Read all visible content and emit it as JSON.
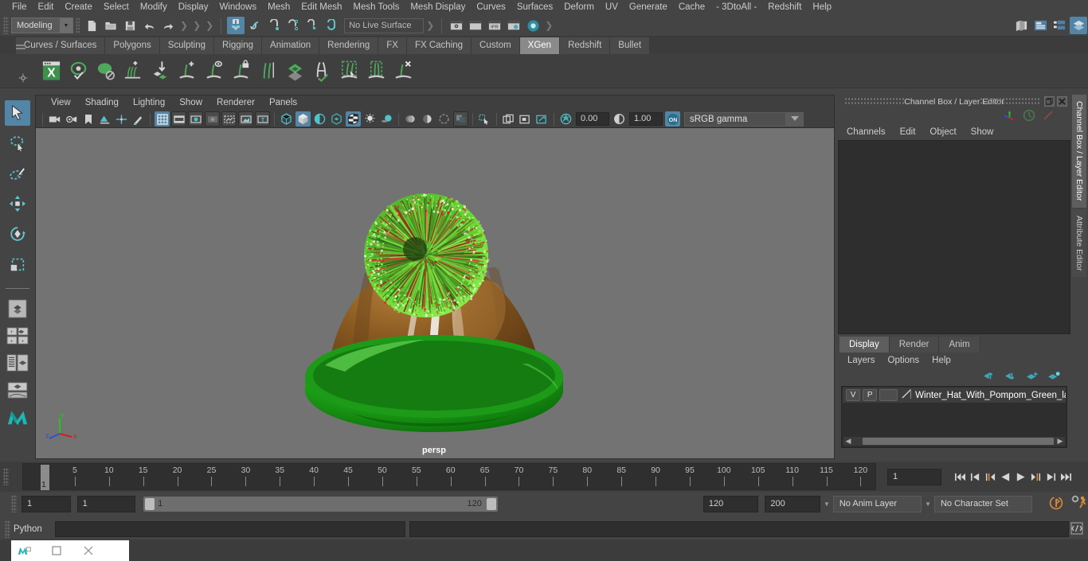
{
  "menubar": {
    "items": [
      "File",
      "Edit",
      "Create",
      "Select",
      "Modify",
      "Display",
      "Windows",
      "Mesh",
      "Edit Mesh",
      "Mesh Tools",
      "Mesh Display",
      "Curves",
      "Surfaces",
      "Deform",
      "UV",
      "Generate",
      "Cache",
      "- 3DtoAll -",
      "Redshift",
      "Help"
    ]
  },
  "statusline": {
    "mode": "Modeling",
    "live_surface": "No Live Surface",
    "icons": [
      "new-scene-icon",
      "open-scene-icon",
      "save-scene-icon",
      "undo-icon",
      "redo-icon",
      "select-by-hierarchy-icon",
      "select-by-object-icon",
      "select-by-component-icon",
      "snap-to-grid-icon",
      "snap-to-curve-icon",
      "snap-to-point-icon",
      "snap-to-projected-center-icon",
      "snap-to-view-plane-icon",
      "make-live-icon",
      "render-view-icon",
      "render-current-frame-icon",
      "ipr-render-icon",
      "render-settings-icon",
      "hypershade-icon"
    ],
    "right_icons": [
      "show-hide-modeling-panel-icon",
      "show-hide-attribute-panel-icon",
      "show-hide-tool-settings-icon",
      "show-hide-channel-box-icon"
    ],
    "ipr_label": "IPR"
  },
  "shelf": {
    "tabs": [
      "Curves / Surfaces",
      "Polygons",
      "Sculpting",
      "Rigging",
      "Animation",
      "Rendering",
      "FX",
      "FX Caching",
      "Custom",
      "XGen",
      "Redshift",
      "Bullet"
    ],
    "active_tab": "XGen",
    "icons": [
      "xgen-editor-icon",
      "xgen-preview-visible-icon",
      "xgen-preview-off-icon",
      "xgen-add-description-icon",
      "xgen-import-collection-icon",
      "xgen-add-guide-icon",
      "xgen-select-guide-icon",
      "xgen-freeze-guide-icon",
      "xgen-duplicate-guide-icon",
      "xgen-convert-primitives-icon",
      "xgen-groom-tool-icon",
      "xgen-guide-region-icon",
      "xgen-clump-modifier-icon",
      "xgen-delete-guide-icon"
    ]
  },
  "toolbox": {
    "tools": [
      "select-tool",
      "lasso-select-tool",
      "paint-select-tool",
      "move-tool",
      "rotate-tool",
      "scale-tool"
    ],
    "active_tool": "select-tool",
    "layout_buttons": [
      "single-perspective-view-icon",
      "four-view-layout-icon",
      "outliner-persp-layout-icon",
      "persp-graph-layout-icon",
      "hypershade-persp-layout-icon",
      "maya-logo-icon"
    ]
  },
  "viewport": {
    "panel_menus": [
      "View",
      "Shading",
      "Lighting",
      "Show",
      "Renderer",
      "Panels"
    ],
    "camera_label": "persp",
    "exposure_value": "0.00",
    "gamma_value": "1.00",
    "color_space": "sRGB gamma",
    "toolbar_icons": [
      "select-camera-icon",
      "camera-attributes-icon",
      "bookmark-icon",
      "image-plane-icon",
      "two-d-pan-zoom-icon",
      "grease-pencil-icon",
      "grid-toggle-icon",
      "film-gate-icon",
      "resolution-gate-icon",
      "gate-mask-icon",
      "film-origin-icon",
      "safe-action-icon",
      "safe-title-icon",
      "wireframe-icon",
      "smooth-shade-all-icon",
      "shaded-wireframe-icon",
      "use-all-lights-icon",
      "shadows-icon",
      "screen-space-ao-icon",
      "motion-blur-icon",
      "multisample-aa-icon",
      "depth-of-field-icon",
      "isolate-select-icon",
      "xray-icon",
      "xray-joints-icon",
      "xray-active-components-icon",
      "exposure-icon",
      "gamma-icon",
      "view-transform-icon"
    ],
    "axis_labels": {
      "x": "x",
      "y": "y",
      "z": "z"
    },
    "scene": {
      "object_name": "Winter Hat With Pompom Green",
      "hat_body_color": "#8a5a21",
      "hat_brim_color": "#1f9f1a",
      "pompom_color_a": "#4fbf1f",
      "pompom_color_b": "#c11f1f",
      "background_color": "#737373"
    }
  },
  "channel_box": {
    "title": "Channel Box / Layer Editor",
    "menus": [
      "Channels",
      "Edit",
      "Object",
      "Show"
    ],
    "header_icons": [
      "axis-orientation-icon",
      "channel-speed-icon",
      "channel-key-icon"
    ],
    "window_buttons": [
      "undock-icon",
      "close-icon"
    ]
  },
  "layer_editor": {
    "tabs": [
      "Display",
      "Render",
      "Anim"
    ],
    "active_tab": "Display",
    "menus": [
      "Layers",
      "Options",
      "Help"
    ],
    "buttons": [
      "move-layer-up-icon",
      "move-layer-down-icon",
      "create-new-layer-icon",
      "create-layer-from-selected-icon"
    ],
    "columns": [
      "V",
      "P"
    ],
    "layers": [
      {
        "visible": "V",
        "playback": "P",
        "name": "Winter_Hat_With_Pompom_Green_lay"
      }
    ]
  },
  "side_tabs": {
    "items": [
      "Channel Box / Layer Editor",
      "Attribute Editor"
    ],
    "active": "Channel Box / Layer Editor"
  },
  "time_slider": {
    "current_frame": "1",
    "frame_field": "1",
    "ticks": [
      5,
      10,
      15,
      20,
      25,
      30,
      35,
      40,
      45,
      50,
      55,
      60,
      65,
      70,
      75,
      80,
      85,
      90,
      95,
      100,
      105,
      110,
      115,
      120
    ],
    "playback_buttons": [
      "go-to-start-icon",
      "step-back-keyframe-icon",
      "step-back-frame-icon",
      "play-backwards-icon",
      "play-forwards-icon",
      "step-forward-frame-icon",
      "step-forward-keyframe-icon",
      "go-to-end-icon"
    ]
  },
  "range_slider": {
    "anim_start": "1",
    "range_start": "1",
    "range_bar_start": "1",
    "range_bar_end": "120",
    "range_end": "120",
    "anim_end": "200",
    "anim_layer": "No Anim Layer",
    "character_set": "No Character Set",
    "right_icons": [
      "auto-keyframe-icon",
      "animation-preferences-icon"
    ]
  },
  "command_line": {
    "label": "Python",
    "input_value": "",
    "result_value": "",
    "script-editor-icon": "script-editor-icon"
  },
  "taskbar": {
    "icons": [
      "maya-app-icon",
      "restore-window-icon",
      "close-window-icon"
    ]
  }
}
